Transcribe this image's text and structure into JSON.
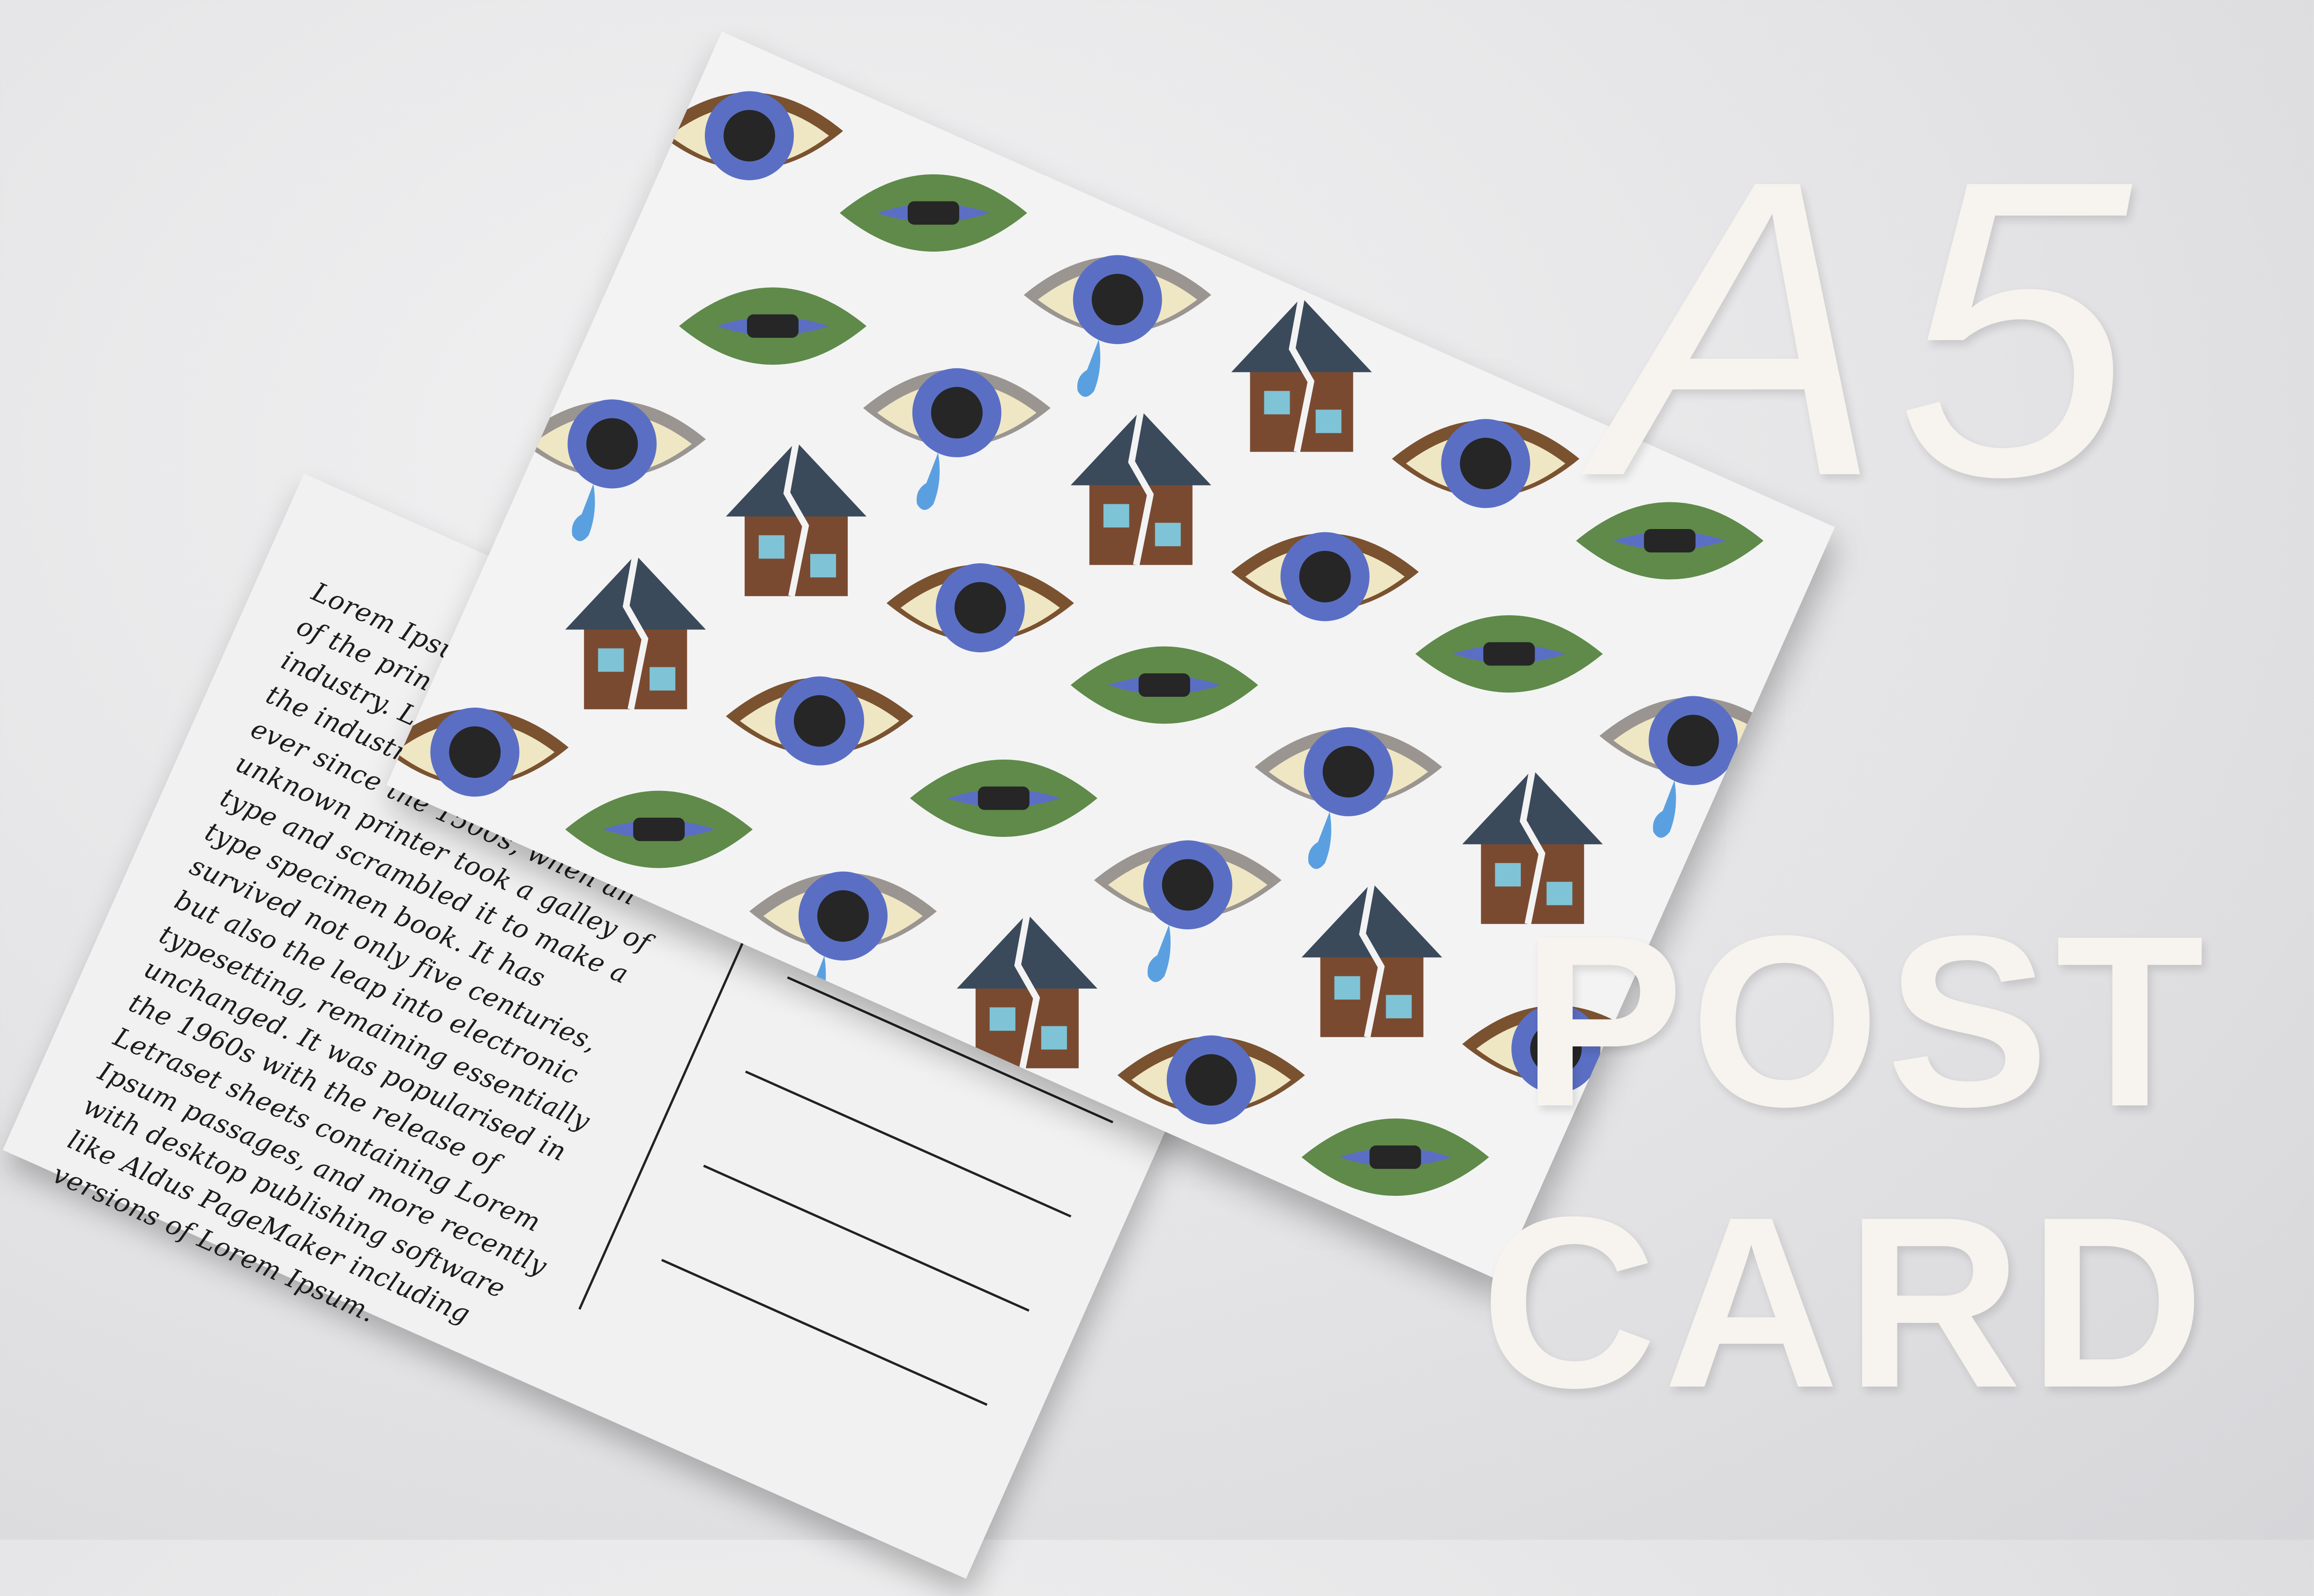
{
  "headline": {
    "size_label": "A5",
    "word_post": "POST",
    "word_card": "CARD"
  },
  "postcard_back": {
    "message_text": "Lorem Ipsum is simply dummy text of the printing and typesetting industry. Lorem Ipsum has been the industry's standard dummy text ever since the 1500s, when an unknown printer took a galley of type and scrambled it to make a type specimen book. It has survived not only five centuries, but also the leap into electronic typesetting, remaining essentially unchanged. It was popularised in the 1960s with the release of Letraset sheets containing Lorem Ipsum passages, and more recently with desktop publishing software like Aldus PageMaker including versions of Lorem Ipsum.",
    "address_line_count": 4
  },
  "postcard_front": {
    "pattern_motifs": [
      "brown-eye-icon",
      "green-eye-icon",
      "crying-eye-icon",
      "cracked-house-icon"
    ]
  },
  "colors": {
    "background": "#e4e4e6",
    "headline_text": "#f7f4ef",
    "card_paper": "#f3f3f4",
    "eye_blue": "#5a6fc4",
    "eye_sclera": "#efe7c4",
    "brown_lid": "#7a5230",
    "green_lid": "#5f8a4a",
    "grey_lid": "#9a9590",
    "house_roof": "#3b4a5a",
    "house_wall": "#7a4a30",
    "tear": "#5aa0e0"
  }
}
